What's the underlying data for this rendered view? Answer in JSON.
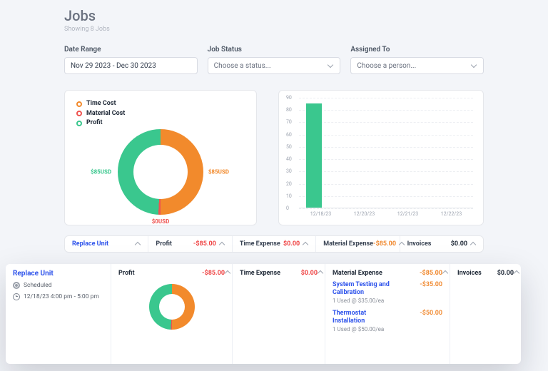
{
  "header": {
    "title": "Jobs",
    "subtitle": "Showing 8 Jobs"
  },
  "filters": {
    "date_range": {
      "label": "Date Range",
      "value": "Nov 29 2023 - Dec 30 2023"
    },
    "job_status": {
      "label": "Job Status",
      "placeholder": "Choose a status..."
    },
    "assigned_to": {
      "label": "Assigned To",
      "placeholder": "Choose a person..."
    }
  },
  "donut_legend": {
    "time": "Time Cost",
    "material": "Material Cost",
    "profit": "Profit"
  },
  "donut_labels": {
    "right": "$85USD",
    "left": "$85USD",
    "bottom": "$0USD"
  },
  "summary": {
    "unit": "Replace Unit",
    "profit_label": "Profit",
    "profit_value": "-$85.00",
    "time_label": "Time Expense",
    "time_value": "$0.00",
    "mat_label": "Material Expense",
    "mat_value": "-$85.00",
    "inv_label": "Invoices",
    "inv_value": "$0.00"
  },
  "detail": {
    "job_title": "Replace Unit",
    "status": "Scheduled",
    "schedule": "12/18/23 4:00 pm - 5:00 pm",
    "profit_label": "Profit",
    "profit_value": "-$85.00",
    "time_label": "Time Expense",
    "time_value": "$0.00",
    "mat_label": "Material Expense",
    "mat_value": "-$85.00",
    "inv_label": "Invoices",
    "inv_value": "$0.00",
    "materials": [
      {
        "name": "System Testing and Calibration",
        "sub": "1 Used @ $35.00/ea",
        "price": "-$35.00"
      },
      {
        "name": "Thermostat Installation",
        "sub": "1 Used @ $50.00/ea",
        "price": "-$50.00"
      }
    ]
  },
  "chart_data": {
    "donut": {
      "type": "pie",
      "title": "",
      "series": [
        {
          "name": "Time Cost",
          "value": 85,
          "color": "#f28a2c"
        },
        {
          "name": "Material Cost",
          "value": 0,
          "color": "#ef5350"
        },
        {
          "name": "Profit",
          "value": 85,
          "color": "#3ac78e"
        }
      ],
      "unit": "USD"
    },
    "bar": {
      "type": "bar",
      "categories": [
        "12/18/23",
        "12/20/23",
        "12/21/23",
        "12/22/23"
      ],
      "values": [
        85,
        0,
        0,
        0
      ],
      "ylim": [
        0,
        90
      ],
      "yticks": [
        0,
        10,
        20,
        30,
        40,
        50,
        60,
        70,
        80,
        90
      ],
      "color": "#3ac78e"
    }
  }
}
